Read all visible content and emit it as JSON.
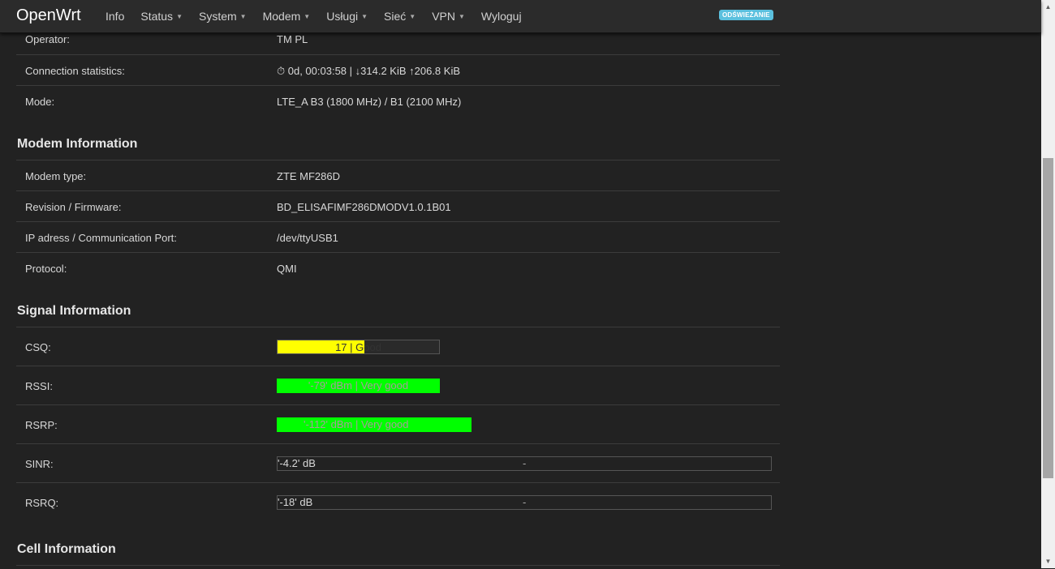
{
  "brand": "OpenWrt",
  "nav": {
    "info": "Info",
    "status": "Status",
    "system": "System",
    "modem": "Modem",
    "uslugi": "Usługi",
    "siec": "Sieć",
    "vpn": "VPN",
    "logout": "Wyloguj"
  },
  "refresh_badge": "ODŚWIEŻANIE",
  "connection": {
    "operator_label": "Operator:",
    "operator_value": "TM PL",
    "stats_label": "Connection statistics:",
    "stats_value": "⏱ 0d, 00:03:58 | ↓314.2 KiB ↑206.8 KiB",
    "mode_label": "Mode:",
    "mode_value": "LTE_A B3 (1800 MHz) / B1 (2100 MHz)"
  },
  "modem_info": {
    "title": "Modem Information",
    "type_label": "Modem type:",
    "type_value": "ZTE MF286D",
    "firmware_label": "Revision / Firmware:",
    "firmware_value": "BD_ELISAFIMF286DMODV1.0.1B01",
    "port_label": "IP adress / Communication Port:",
    "port_value": "/dev/ttyUSB1",
    "protocol_label": "Protocol:",
    "protocol_value": "QMI"
  },
  "signal_info": {
    "title": "Signal Information",
    "csq_label": "CSQ:",
    "csq_text": "17 | Good",
    "csq_fill": 0.54,
    "csq_color": "#ffff00",
    "rssi_label": "RSSI:",
    "rssi_text": "'-79' dBm | Very good",
    "rssi_fill": 1.0,
    "rssi_color": "#00ff00",
    "rsrp_label": "RSRP:",
    "rsrp_text": "'-112' dBm | Very good",
    "rsrp_color": "#00ff00",
    "sinr_label": "SINR:",
    "sinr_value": "'-4.2' dB",
    "sinr_center": "-",
    "rsrq_label": "RSRQ:",
    "rsrq_value": "'-18' dB",
    "rsrq_center": "-"
  },
  "cell_info": {
    "title": "Cell Information"
  }
}
